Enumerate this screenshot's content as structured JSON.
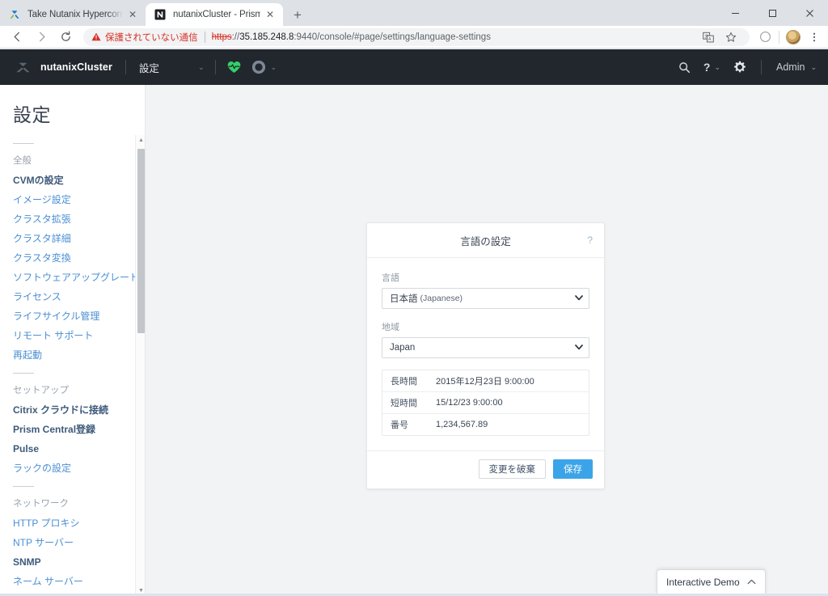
{
  "browser": {
    "tabs": [
      {
        "title": "Take Nutanix Hyperconverged Inf",
        "favicon": "nutanix-x-logo",
        "active": false,
        "close_label": "✕"
      },
      {
        "title": "nutanixCluster - Prism Element",
        "favicon": "prism-element-favicon",
        "active": true,
        "close_label": "✕"
      }
    ],
    "new_tab_label": "+",
    "window_controls": {
      "minimize": "–",
      "maximize": "☐",
      "close": "✕"
    },
    "nav": {
      "back": "←",
      "forward": "→",
      "reload": "↻"
    },
    "omnibox": {
      "security_warning": "保護されていない通信",
      "warning_icon": "warning-triangle-icon",
      "url_scheme": "https",
      "url_separator": "://",
      "url_host": "35.185.248.8",
      "url_rest": ":9440/console/#page/settings/language-settings",
      "full_url": "https://35.185.248.8:9440/console/#page/settings/language-settings"
    },
    "toolbar_icons": [
      "translate-icon",
      "bookmark-star-icon",
      "profile-circle-icon",
      "account-avatar",
      "kebab-menu-icon"
    ]
  },
  "app_header": {
    "logo": "nutanix-x-logo",
    "cluster_name": "nutanixCluster",
    "page_name": "設定",
    "page_caret": "⌄",
    "health_icon": "green-heart-pulse-icon",
    "status_ring_icon": "gray-ring-icon",
    "status_caret": "⌄",
    "search_icon": "search-icon",
    "help_icon": "?",
    "help_caret": "⌄",
    "settings_icon": "gear-icon",
    "user_label": "Admin",
    "user_caret": "⌄"
  },
  "sidebar": {
    "title": "設定",
    "groups": [
      {
        "label": "全般",
        "items": [
          {
            "label": "CVMの設定",
            "strong": true
          },
          {
            "label": "イメージ設定",
            "strong": false
          },
          {
            "label": "クラスタ拡張",
            "strong": false
          },
          {
            "label": "クラスタ詳細",
            "strong": false
          },
          {
            "label": "クラスタ変換",
            "strong": false
          },
          {
            "label": "ソフトウェアアップグレード",
            "strong": false
          },
          {
            "label": "ライセンス",
            "strong": false
          },
          {
            "label": "ライフサイクル管理",
            "strong": false
          },
          {
            "label": "リモート サポート",
            "strong": false
          },
          {
            "label": "再起動",
            "strong": false
          }
        ]
      },
      {
        "label": "セットアップ",
        "items": [
          {
            "label": "Citrix クラウドに接続",
            "strong": true
          },
          {
            "label": "Prism Central登録",
            "strong": true
          },
          {
            "label": "Pulse",
            "strong": true
          },
          {
            "label": "ラックの設定",
            "strong": false
          }
        ]
      },
      {
        "label": "ネットワーク",
        "items": [
          {
            "label": "HTTP プロキシ",
            "strong": false
          },
          {
            "label": "NTP サーバー",
            "strong": false
          },
          {
            "label": "SNMP",
            "strong": true
          },
          {
            "label": "ネーム サーバー",
            "strong": false
          }
        ]
      }
    ],
    "scrollbar": {
      "up_arrow": "▲",
      "down_arrow": "▼"
    }
  },
  "dialog": {
    "title": "言語の設定",
    "help_icon": "?",
    "language": {
      "label": "言語",
      "value_main": "日本語",
      "value_sub": "(Japanese)",
      "caret": "⌄"
    },
    "region": {
      "label": "地域",
      "value": "Japan",
      "caret": "⌄"
    },
    "preview_rows": [
      {
        "key": "長時間",
        "value": "2015年12月23日 9:00:00"
      },
      {
        "key": "短時間",
        "value": "15/12/23 9:00:00"
      },
      {
        "key": "番号",
        "value": "1,234,567.89"
      }
    ],
    "discard_button": "変更を破棄",
    "save_button": "保存"
  },
  "demo_widget": {
    "label": "Interactive Demo",
    "caret": "⌃"
  },
  "colors": {
    "header_bg": "#22272e",
    "page_bg": "#f2f3f5",
    "link_blue": "#4a8fd4",
    "primary_button": "#3ba4e8",
    "health_green": "#4cd964",
    "warning_red": "#d93025"
  }
}
